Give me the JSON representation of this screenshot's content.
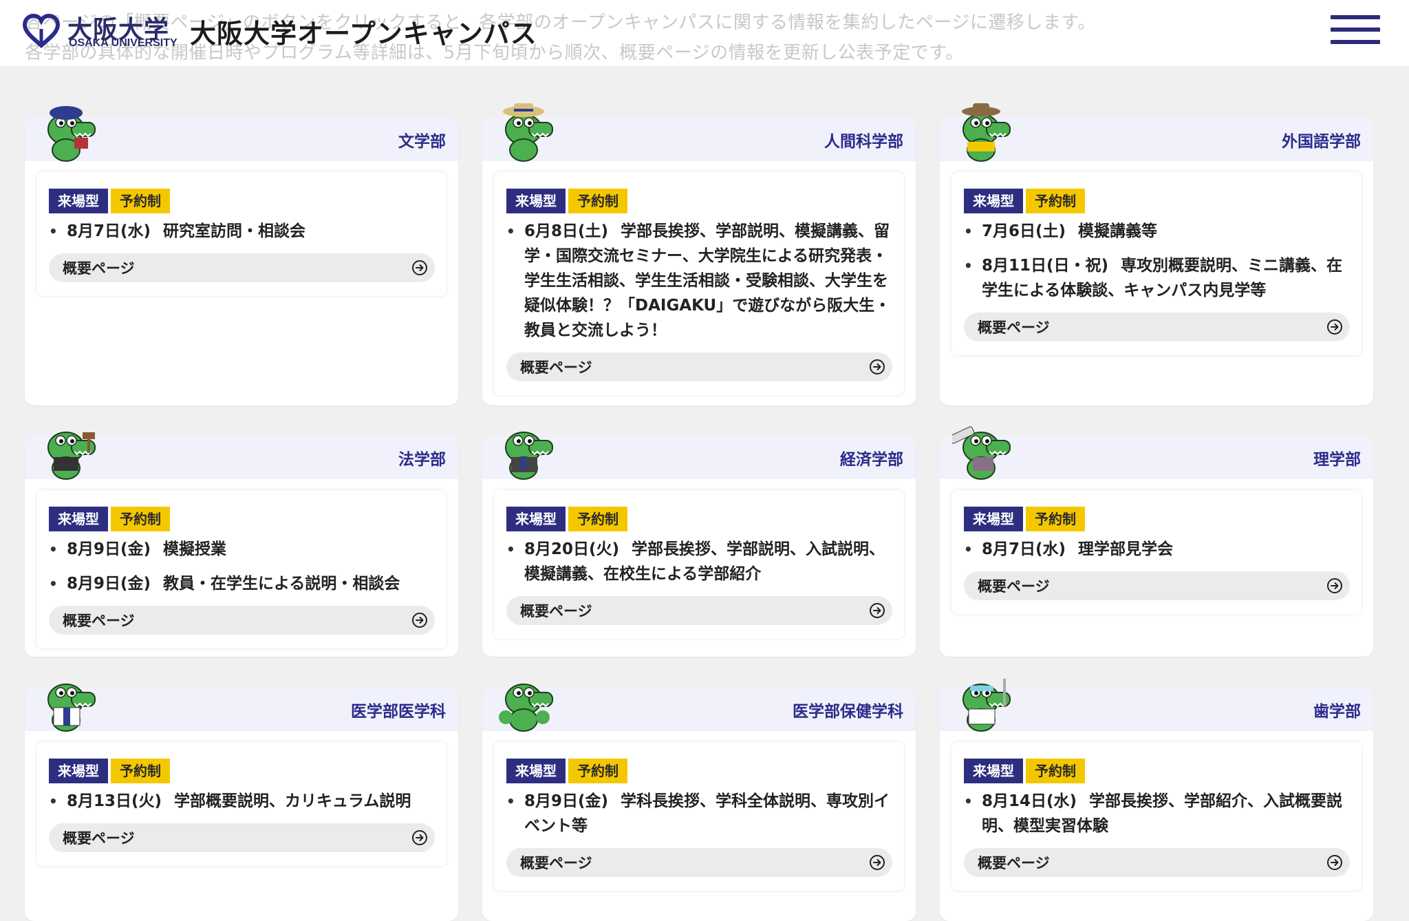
{
  "header": {
    "ghost_line1": "各ページの「概要ページ」のボタンをクリックすると、各学部のオープンキャンパスに関する情報を集約したページに遷移します。",
    "ghost_line2": "各学部の具体的な開催日時やプログラム等詳細は、5月下旬頃から順次、概要ページの情報を更新し公表予定です。",
    "logo_jp": "大阪大学",
    "logo_en": "OSAKA UNIVERSITY",
    "title": "大阪大学オープンキャンパス",
    "menu_icon": "hamburger-menu-icon"
  },
  "labels": {
    "venue": "来場型",
    "reserve": "予約制",
    "overview": "概要ページ"
  },
  "colors": {
    "brand_navy": "#2e2e80",
    "badge_yellow": "#f4c800",
    "card_header_bg": "#f1f1fc",
    "page_bg": "#f0f0f0"
  },
  "faculties": [
    {
      "name": "文学部",
      "mascot": "crocodile-beret-book-icon",
      "events": [
        {
          "date": "8月7日(水)",
          "desc": "研究室訪問・相談会"
        }
      ]
    },
    {
      "name": "人間科学部",
      "mascot": "crocodile-straw-hat-icon",
      "events": [
        {
          "date": "6月8日(土)",
          "desc": "学部長挨拶、学部説明、模擬講義、留学・国際交流セミナー、大学院生による研究発表・学生生活相談、学生生活相談・受験相談、大学生を疑似体験！？「DAIGAKU」で遊びながら阪大生・教員と交流しよう！"
        }
      ]
    },
    {
      "name": "外国語学部",
      "mascot": "crocodile-explorer-icon",
      "events": [
        {
          "date": "7月6日(土)",
          "desc": "模擬講義等"
        },
        {
          "date": "8月11日(日・祝)",
          "desc": "専攻別概要説明、ミニ講義、在学生による体験談、キャンパス内見学等"
        }
      ]
    },
    {
      "name": "法学部",
      "mascot": "crocodile-gavel-icon",
      "events": [
        {
          "date": "8月9日(金)",
          "desc": "模擬授業"
        },
        {
          "date": "8月9日(金)",
          "desc": "教員・在学生による説明・相談会"
        }
      ]
    },
    {
      "name": "経済学部",
      "mascot": "crocodile-suit-icon",
      "events": [
        {
          "date": "8月20日(火)",
          "desc": "学部長挨拶、学部説明、入試説明、模擬講義、在校生による学部紹介"
        }
      ]
    },
    {
      "name": "理学部",
      "mascot": "crocodile-telescope-icon",
      "events": [
        {
          "date": "8月7日(水)",
          "desc": "理学部見学会"
        }
      ]
    },
    {
      "name": "医学部医学科",
      "mascot": "crocodile-doctor-icon",
      "events": [
        {
          "date": "8月13日(火)",
          "desc": "学部概要説明、カリキュラム説明"
        }
      ]
    },
    {
      "name": "医学部保健学科",
      "mascot": "crocodile-group-icon",
      "events": [
        {
          "date": "8月9日(金)",
          "desc": "学科長挨拶、学科全体説明、専攻別イベント等"
        }
      ]
    },
    {
      "name": "歯学部",
      "mascot": "crocodile-dentist-icon",
      "events": [
        {
          "date": "8月14日(水)",
          "desc": "学部長挨拶、学部紹介、入試概要説明、模型実習体験"
        }
      ]
    }
  ]
}
